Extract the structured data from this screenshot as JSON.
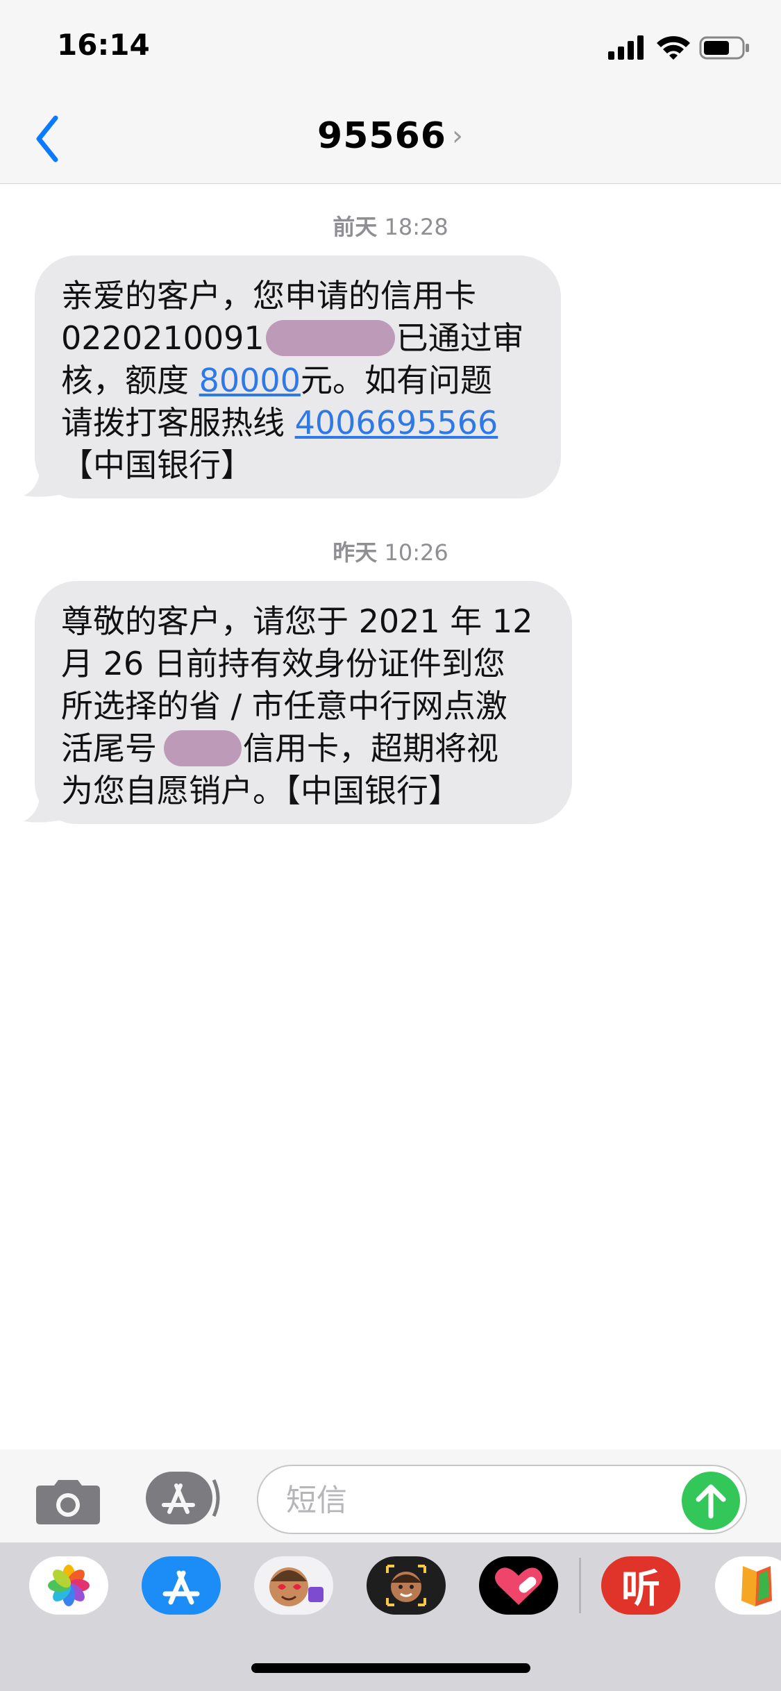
{
  "status_bar": {
    "time": "16:14"
  },
  "header": {
    "contact_name": "95566",
    "detail_chevron": "›"
  },
  "messages": [
    {
      "timestamp_day": "前天",
      "timestamp_time": "18:28",
      "line1": "亲爱的客户，您申请的信用卡",
      "line2_prefix": "0220210091",
      "line2_suffix": "已通过审",
      "line3_prefix": "核，额度",
      "credit_limit": "80000",
      "line3_suffix": "元。如有问题",
      "line4_prefix": "请拨打客服热线",
      "hotline": "4006695566",
      "line5": "【中国银行】"
    },
    {
      "timestamp_day": "昨天",
      "timestamp_time": "10:26",
      "line1": "尊敬的客户，请您于 2021 年 12",
      "line2": "月 26 日前持有效身份证件到您",
      "line3": "所选择的省 / 市任意中行网点激",
      "line4_prefix": "活尾号",
      "line4_suffix": "信用卡，超期将视",
      "line5": "为您自愿销户。【中国银行】"
    }
  ],
  "compose": {
    "placeholder": "短信"
  },
  "app_drawer": {
    "apps": [
      "photos-app",
      "app-store-app",
      "memoji-stickers-app",
      "animoji-app",
      "digital-touch-app",
      "ting-app",
      "books-app"
    ],
    "ting_label": "听"
  },
  "colors": {
    "bubble": "#e9e9eb",
    "link": "#2f79e7",
    "ios_blue": "#0a7aff",
    "send_green": "#33c759"
  }
}
